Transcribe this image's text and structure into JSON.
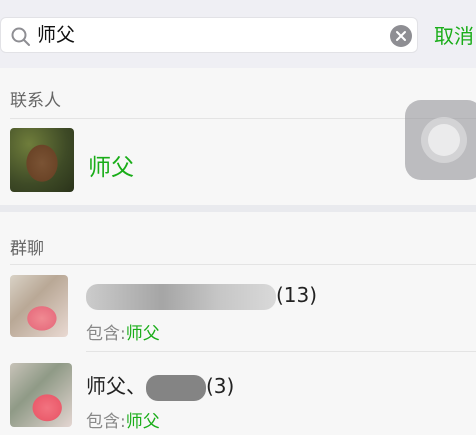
{
  "search": {
    "query": "师父",
    "cancel_label": "取消"
  },
  "contacts": {
    "header": "联系人",
    "items": [
      {
        "name": "师父"
      }
    ]
  },
  "groups": {
    "header": "群聊",
    "items": [
      {
        "name_suffix": "(13)",
        "contains_label": "包含:",
        "contains_match": "师父"
      },
      {
        "name_prefix": "师父、",
        "name_suffix": "(3)",
        "contains_label": "包含:",
        "contains_match": "师父"
      }
    ]
  },
  "colors": {
    "accent": "#1aad19",
    "background": "#f2f2f4"
  },
  "icons": [
    "search-icon",
    "clear-icon",
    "assistive-touch-icon"
  ]
}
